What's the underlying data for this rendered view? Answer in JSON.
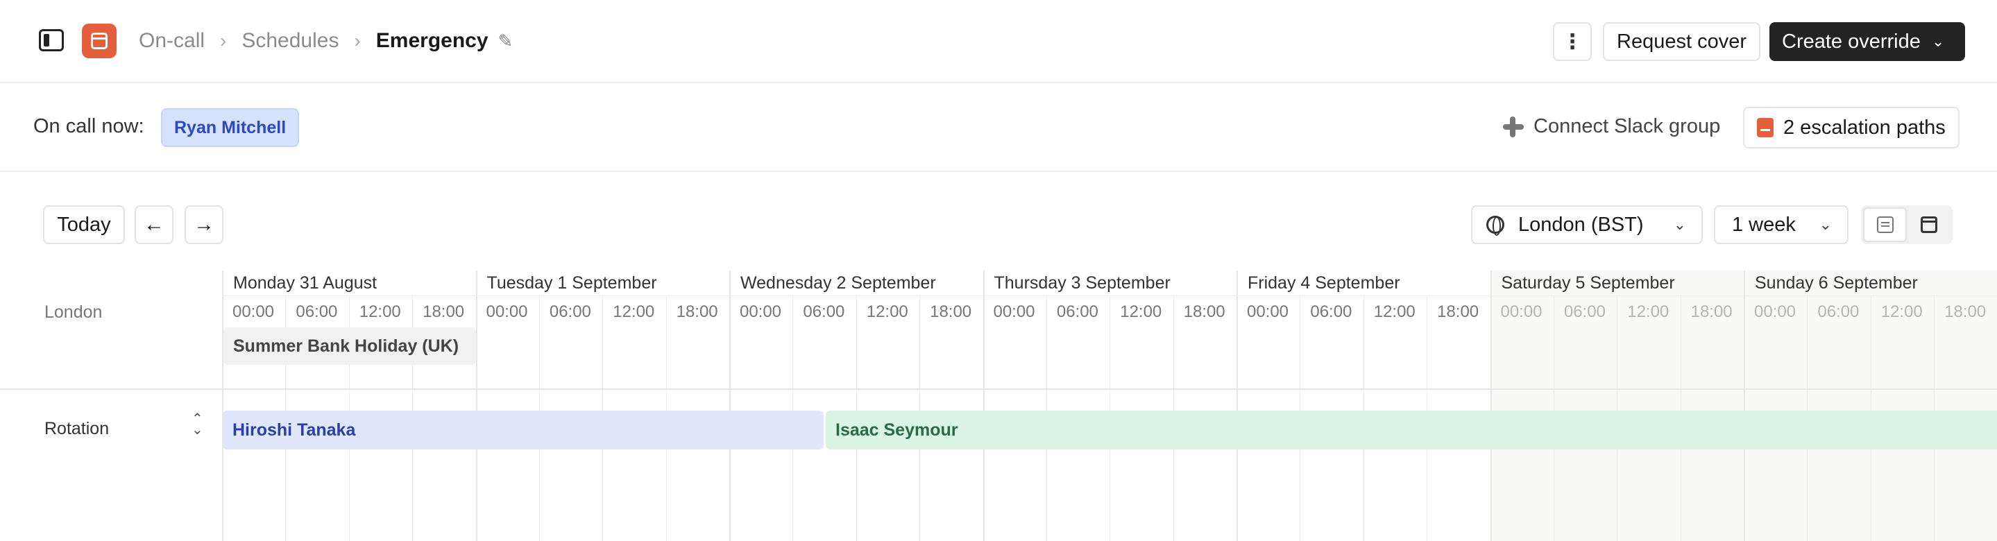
{
  "header": {
    "breadcrumb": [
      "On-call",
      "Schedules"
    ],
    "current": "Emergency",
    "icons": [
      "sidebar-toggle-icon",
      "calendar-app-icon",
      "pencil-icon",
      "kebab-icon",
      "chevron-down-icon"
    ],
    "request_cover_label": "Request cover",
    "create_override_label": "Create override",
    "kebab_glyph": "⋮",
    "accent_color": "#e4603d"
  },
  "oncall": {
    "label": "On call now:",
    "person": "Ryan Mitchell",
    "slack_label": "Connect Slack group",
    "escalation_label": "2 escalation paths"
  },
  "toolbar": {
    "today_label": "Today",
    "prev_glyph": "←",
    "next_glyph": "→",
    "timezone": "London (BST)",
    "range": "1 week"
  },
  "calendar": {
    "days": [
      "Monday 31 August",
      "Tuesday 1 September",
      "Wednesday 2 September",
      "Thursday 3 September",
      "Friday 4 September",
      "Saturday 5 September",
      "Sunday 6 September"
    ],
    "hours": [
      "00:00",
      "06:00",
      "12:00",
      "18:00"
    ],
    "london_row_label": "London",
    "holiday": "Summer Bank Holiday (UK)",
    "rotation_row_label": "Rotation",
    "shifts": [
      {
        "person": "Hiroshi Tanaka",
        "color": "#e0e6fb"
      },
      {
        "person": "Isaac Seymour",
        "color": "#daf5e3"
      }
    ]
  }
}
